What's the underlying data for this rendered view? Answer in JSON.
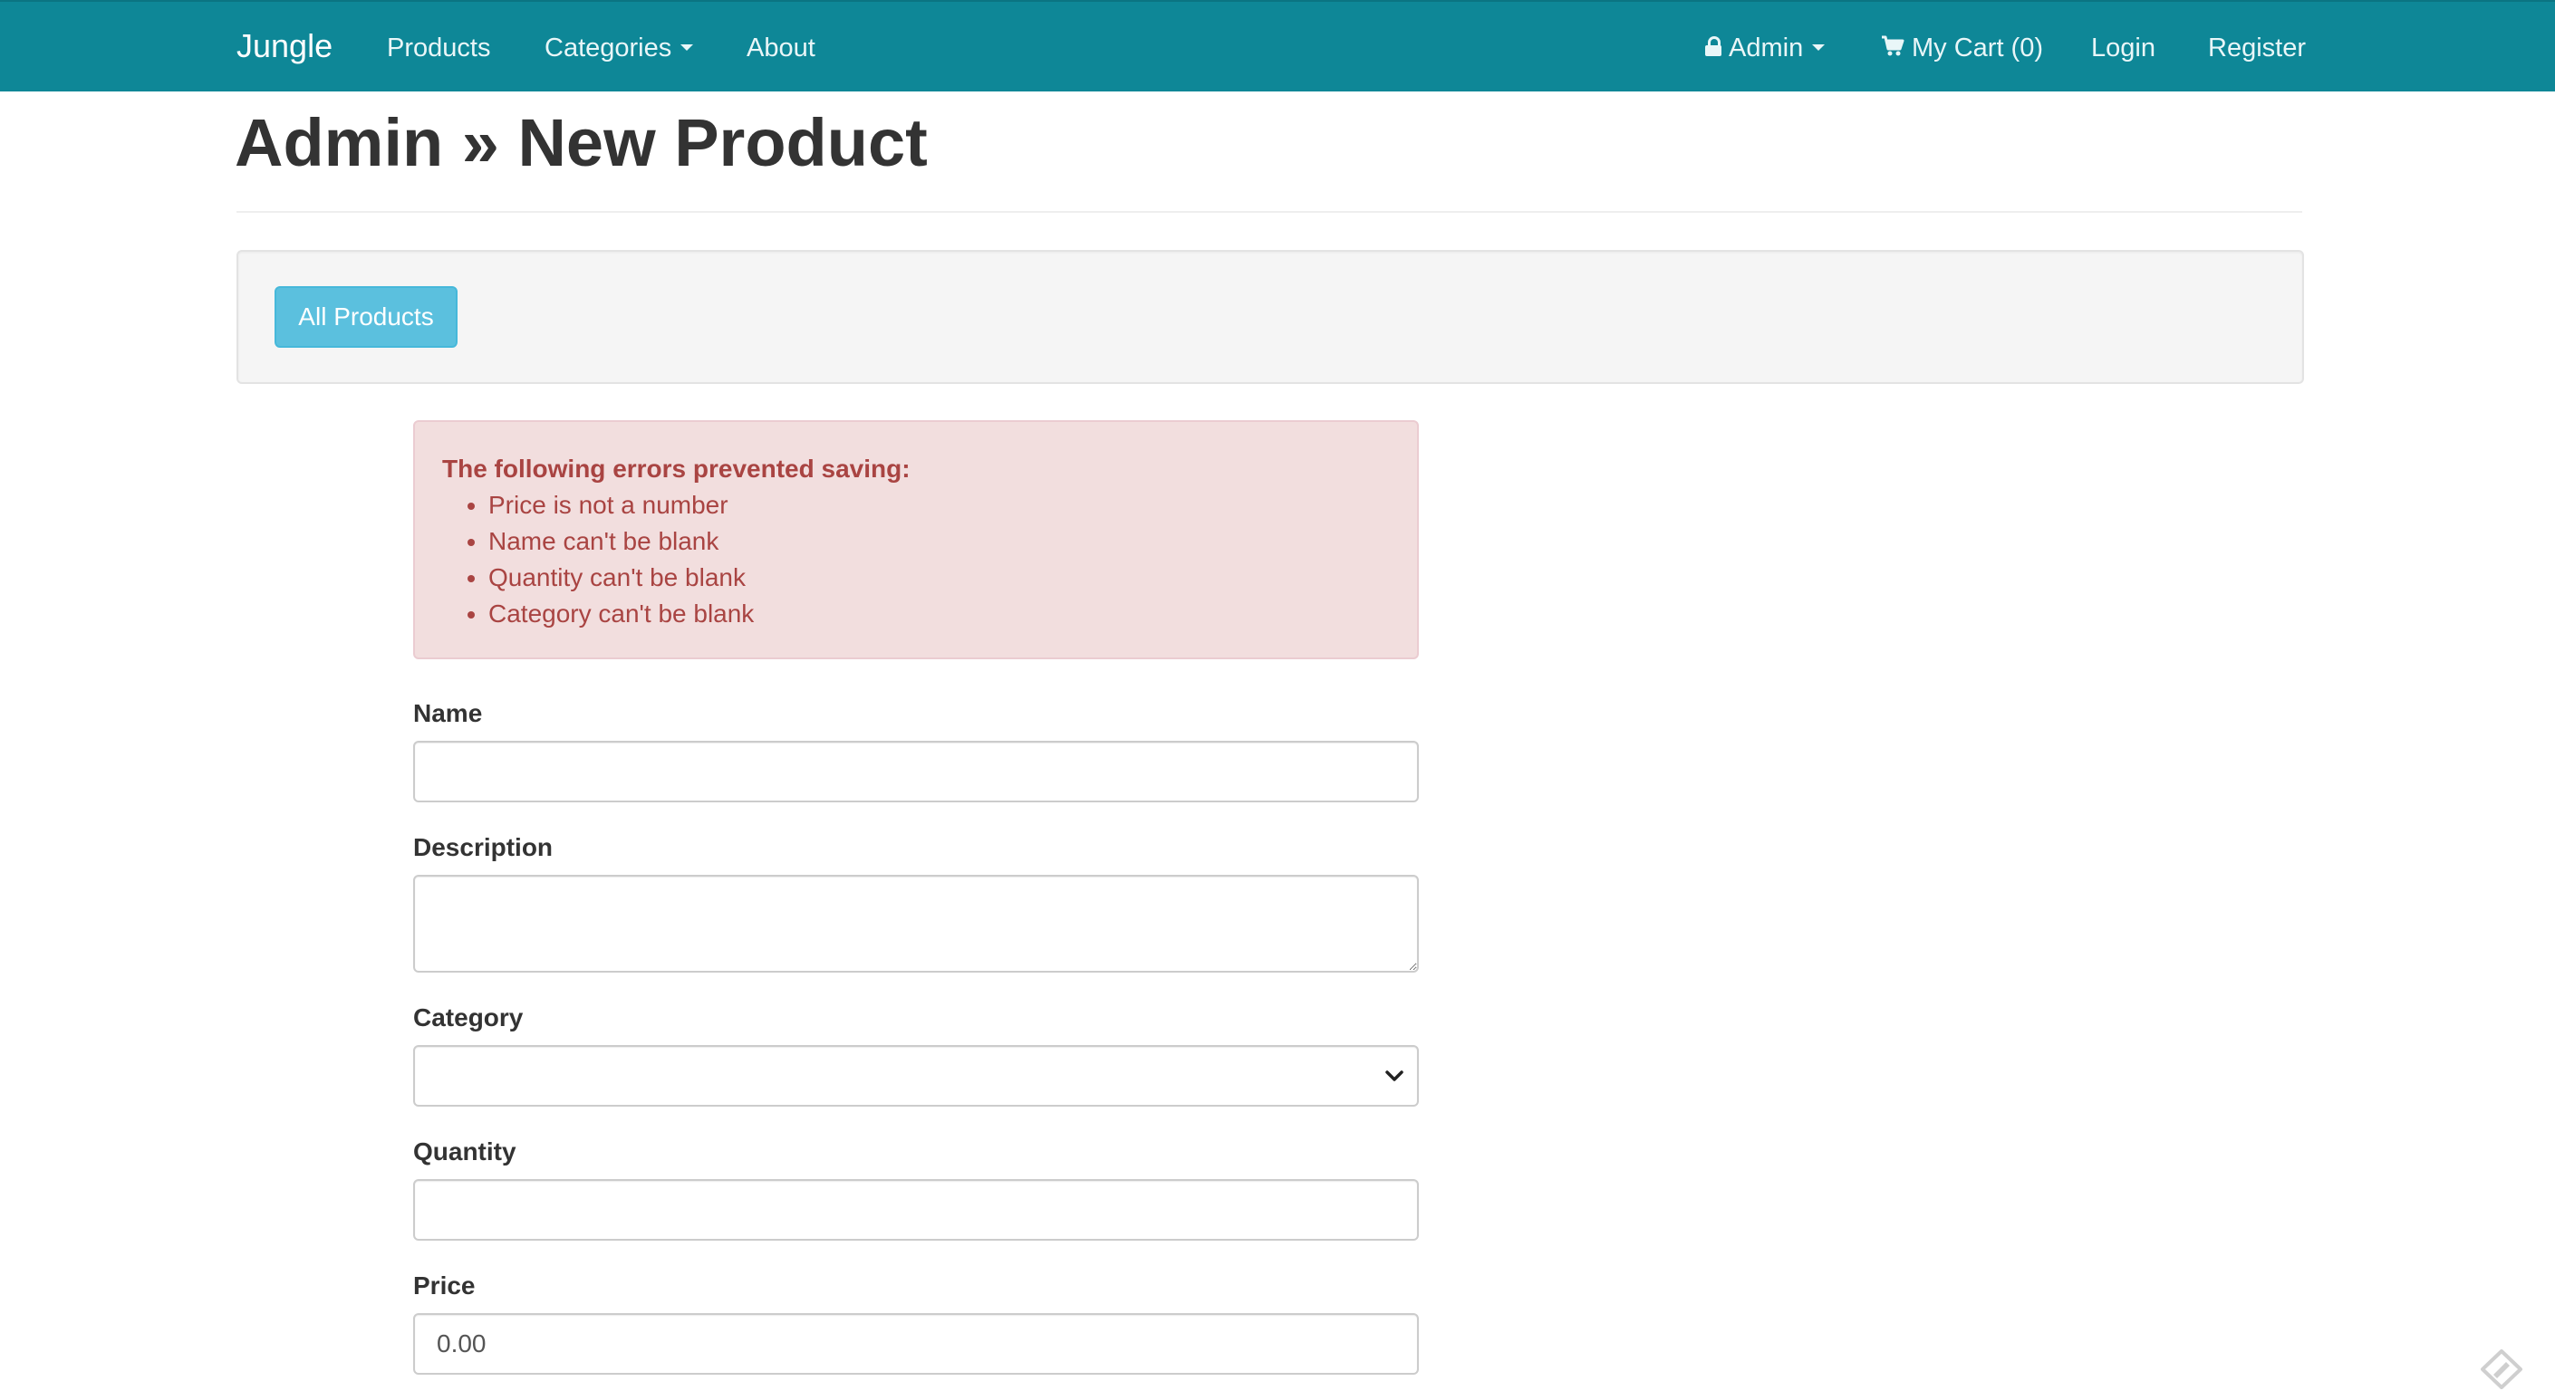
{
  "navbar": {
    "brand": "Jungle",
    "products": "Products",
    "categories": "Categories",
    "about": "About",
    "admin": "Admin",
    "cart": "My Cart (0)",
    "login": "Login",
    "register": "Register"
  },
  "page": {
    "title": "Admin » New Product"
  },
  "well": {
    "all_products_button": "All Products"
  },
  "errors": {
    "title": "The following errors prevented saving:",
    "items": [
      "Price is not a number",
      "Name can't be blank",
      "Quantity can't be blank",
      "Category can't be blank"
    ]
  },
  "form": {
    "name": {
      "label": "Name",
      "value": ""
    },
    "description": {
      "label": "Description",
      "value": ""
    },
    "category": {
      "label": "Category",
      "value": ""
    },
    "quantity": {
      "label": "Quantity",
      "value": ""
    },
    "price": {
      "label": "Price",
      "value": "0.00"
    }
  },
  "colors": {
    "navbar_bg": "#0e8797",
    "button_info": "#5bc0de",
    "alert_bg": "#f2dede",
    "alert_text": "#a94442"
  },
  "icons": {
    "lock": "lock-icon",
    "cart": "shopping-cart-icon",
    "caret": "caret-down-icon",
    "select_chevron": "chevron-down-icon",
    "corner": "diamond-edit-icon"
  }
}
